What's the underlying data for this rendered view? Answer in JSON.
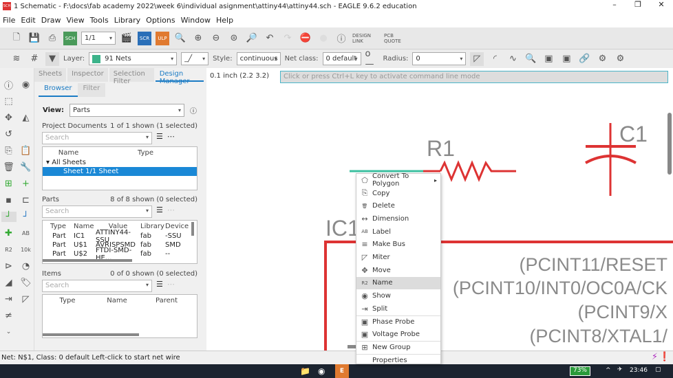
{
  "title": "1 Schematic - F:\\docs\\fab academy 2022\\week 6\\individual asignment\\attiny44\\attiny44.sch - EAGLE 9.6.2 education",
  "menu": [
    "File",
    "Edit",
    "Draw",
    "View",
    "Tools",
    "Library",
    "Options",
    "Window",
    "Help"
  ],
  "toolbar": {
    "sheet": "1/1",
    "design_link": "DESIGN LINK",
    "pcb_quote": "PCB QUOTE"
  },
  "toolbar2": {
    "layer_label": "Layer:",
    "layer_value": "91 Nets",
    "layer_color": "#3cb38a",
    "style_label": "Style:",
    "style_value": "continuous",
    "netclass_label": "Net class:",
    "netclass_value": "0 default",
    "radius_label": "Radius:",
    "radius_value": "0"
  },
  "panel": {
    "tabs": [
      "Sheets",
      "Inspector",
      "Selection Filter",
      "Design Manager"
    ],
    "subtabs": [
      "Browser",
      "Filter"
    ],
    "view_label": "View:",
    "view_value": "Parts",
    "project": {
      "title": "Project Documents",
      "count": "1 of 1 shown (1 selected)",
      "search": "Search",
      "cols": [
        "Name",
        "Type"
      ],
      "group": "All Sheets",
      "selected": "Sheet 1/1  Sheet"
    },
    "parts": {
      "title": "Parts",
      "count": "8 of 8 shown (0 selected)",
      "search": "Search",
      "cols": [
        "Type",
        "Name",
        "Value",
        "Library",
        "Device"
      ],
      "rows": [
        [
          "Part",
          "IC1",
          "ATTINY44-SSU",
          "fab",
          "-SSU"
        ],
        [
          "Part",
          "U$1",
          "AVRISPSMD",
          "fab",
          "SMD"
        ],
        [
          "Part",
          "U$2",
          "FTDI-SMD-HE...",
          "fab",
          "--"
        ]
      ]
    },
    "items": {
      "title": "Items",
      "count": "0 of 0 shown (0 selected)",
      "search": "Search",
      "cols": [
        "Type",
        "Name",
        "Parent"
      ]
    }
  },
  "canvas": {
    "coord": "0.1 inch (2.2 3.2)",
    "cmd_placeholder": "Click or press Ctrl+L key to activate command line mode",
    "r1": "R1",
    "c1": "C1",
    "ic1": "IC1",
    "pins": [
      "(PCINT11/RESET",
      "(PCINT10/INT0/OC0A/CK",
      "(PCINT9/X",
      "(PCINT8/XTAL1/"
    ]
  },
  "context_menu": [
    {
      "label": "Convert To Polygon",
      "icon": "⬠",
      "sub": "▸"
    },
    {
      "label": "Copy",
      "icon": "⎘"
    },
    {
      "label": "Delete",
      "icon": "🗑"
    },
    {
      "label": "Dimension",
      "icon": "↔"
    },
    {
      "label": "Label",
      "icon": "AB"
    },
    {
      "label": "Make Bus",
      "icon": "≡"
    },
    {
      "label": "Miter",
      "icon": "◸"
    },
    {
      "label": "Move",
      "icon": "✥"
    },
    {
      "label": "Name",
      "icon": "R2"
    },
    {
      "label": "Show",
      "icon": "◉"
    },
    {
      "label": "Split",
      "icon": "⇥"
    },
    {
      "label": "Phase Probe",
      "icon": "▣"
    },
    {
      "label": "Voltage Probe",
      "icon": "▣"
    },
    {
      "label": "New Group",
      "icon": "⊞"
    },
    {
      "label": "Properties",
      "icon": ""
    }
  ],
  "status": "Net: N$1, Class: 0 default Left-click to start net wire",
  "taskbar": {
    "battery": "73%",
    "time": "23:46"
  }
}
